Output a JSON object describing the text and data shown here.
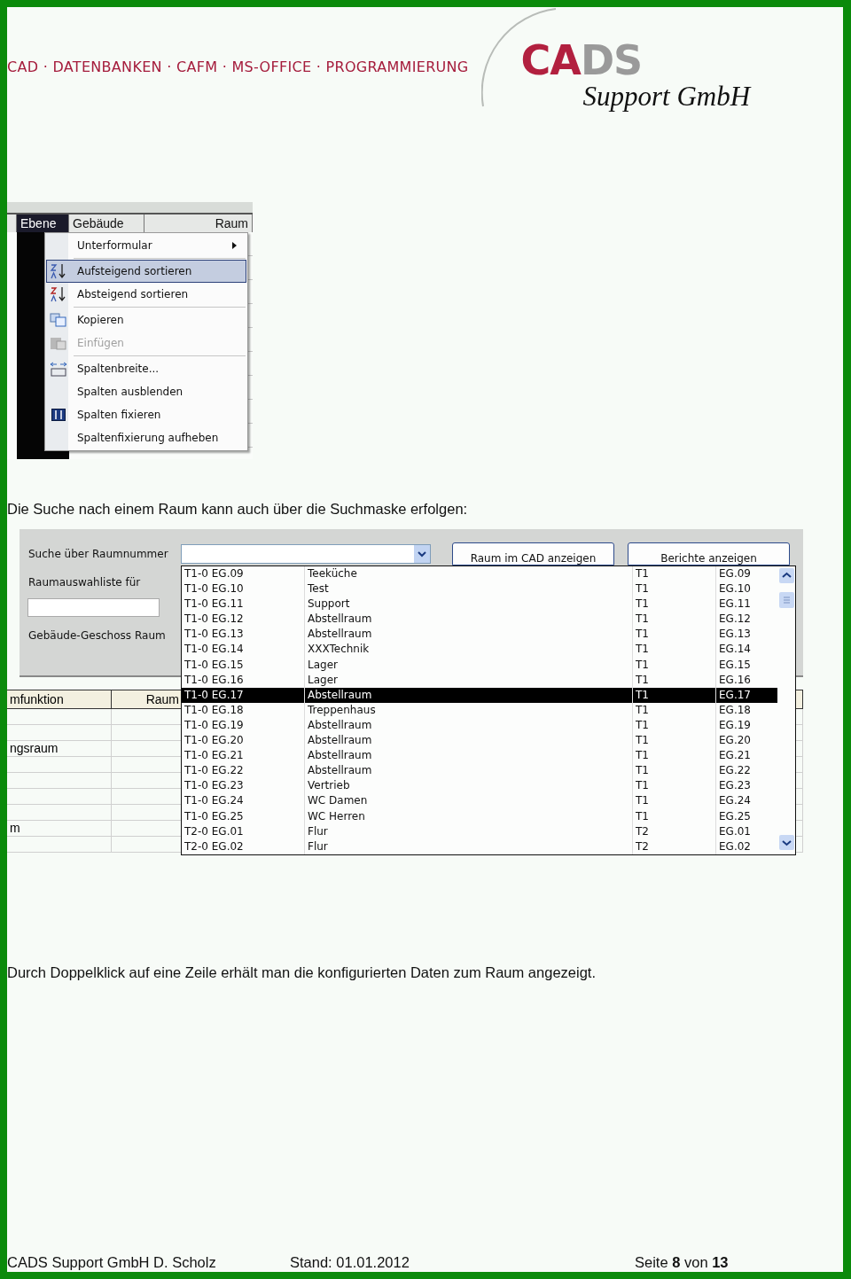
{
  "header": {
    "tagline": "CAD · DATENBANKEN · CAFM · MS-OFFICE · PROGRAMMIERUNG",
    "logo_accent": "CA",
    "logo_rest": "DS",
    "logo_subtitle": "Support GmbH"
  },
  "context_menu_shot": {
    "columns": [
      "Ebene",
      "Gebäude",
      "Raum"
    ],
    "menu_groups": [
      [
        {
          "label": "Unterformular",
          "submenu": true,
          "selected": false,
          "disabled": false
        }
      ],
      [
        {
          "label": "Aufsteigend sortieren",
          "submenu": false,
          "selected": true,
          "disabled": false
        },
        {
          "label": "Absteigend sortieren",
          "submenu": false,
          "selected": false,
          "disabled": false
        }
      ],
      [
        {
          "label": "Kopieren",
          "submenu": false,
          "selected": false,
          "disabled": false
        },
        {
          "label": "Einfügen",
          "submenu": false,
          "selected": false,
          "disabled": true
        }
      ],
      [
        {
          "label": "Spaltenbreite...",
          "submenu": false,
          "selected": false,
          "disabled": false
        },
        {
          "label": "Spalten ausblenden",
          "submenu": false,
          "selected": false,
          "disabled": false
        },
        {
          "label": "Spalten fixieren",
          "submenu": false,
          "selected": false,
          "disabled": false
        },
        {
          "label": "Spaltenfixierung aufheben",
          "submenu": false,
          "selected": false,
          "disabled": false
        }
      ]
    ]
  },
  "paragraph_1": "Die Suche nach einem Raum kann auch über die Suchmaske erfolgen:",
  "search_form_shot": {
    "search_label": "Suche über Raumnummer",
    "list_label": "Raumauswahliste für",
    "column_labels": [
      "Gebäude-Geschoss",
      "Raum"
    ],
    "buttons": [
      "Raum im CAD anzeigen",
      "Berichte anzeigen"
    ],
    "table_headers": [
      "mfunktion",
      "Raum"
    ],
    "table_cells": [
      "",
      "",
      "ngsraum",
      "",
      "",
      "",
      "",
      "m"
    ],
    "dropdown_rows": [
      {
        "cells": [
          "T1-0 EG.09",
          "Teeküche",
          "T1",
          "EG.09"
        ],
        "selected": false
      },
      {
        "cells": [
          "T1-0 EG.10",
          "Test",
          "T1",
          "EG.10"
        ],
        "selected": false
      },
      {
        "cells": [
          "T1-0 EG.11",
          "Support",
          "T1",
          "EG.11"
        ],
        "selected": false
      },
      {
        "cells": [
          "T1-0 EG.12",
          "Abstellraum",
          "T1",
          "EG.12"
        ],
        "selected": false
      },
      {
        "cells": [
          "T1-0 EG.13",
          "Abstellraum",
          "T1",
          "EG.13"
        ],
        "selected": false
      },
      {
        "cells": [
          "T1-0 EG.14",
          "XXXTechnik",
          "T1",
          "EG.14"
        ],
        "selected": false
      },
      {
        "cells": [
          "T1-0 EG.15",
          "Lager",
          "T1",
          "EG.15"
        ],
        "selected": false
      },
      {
        "cells": [
          "T1-0 EG.16",
          "Lager",
          "T1",
          "EG.16"
        ],
        "selected": false
      },
      {
        "cells": [
          "T1-0 EG.17",
          "Abstellraum",
          "T1",
          "EG.17"
        ],
        "selected": true
      },
      {
        "cells": [
          "T1-0 EG.18",
          "Treppenhaus",
          "T1",
          "EG.18"
        ],
        "selected": false
      },
      {
        "cells": [
          "T1-0 EG.19",
          "Abstellraum",
          "T1",
          "EG.19"
        ],
        "selected": false
      },
      {
        "cells": [
          "T1-0 EG.20",
          "Abstellraum",
          "T1",
          "EG.20"
        ],
        "selected": false
      },
      {
        "cells": [
          "T1-0 EG.21",
          "Abstellraum",
          "T1",
          "EG.21"
        ],
        "selected": false
      },
      {
        "cells": [
          "T1-0 EG.22",
          "Abstellraum",
          "T1",
          "EG.22"
        ],
        "selected": false
      },
      {
        "cells": [
          "T1-0 EG.23",
          "Vertrieb",
          "T1",
          "EG.23"
        ],
        "selected": false
      },
      {
        "cells": [
          "T1-0 EG.24",
          "WC Damen",
          "T1",
          "EG.24"
        ],
        "selected": false
      },
      {
        "cells": [
          "T1-0 EG.25",
          "WC Herren",
          "T1",
          "EG.25"
        ],
        "selected": false
      },
      {
        "cells": [
          "T2-0 EG.01",
          "Flur",
          "T2",
          "EG.01"
        ],
        "selected": false
      },
      {
        "cells": [
          "T2-0 EG.02",
          "Flur",
          "T2",
          "EG.02"
        ],
        "selected": false
      }
    ]
  },
  "paragraph_2": "Durch Doppelklick auf eine Zeile erhält man die konfigurierten Daten zum Raum angezeigt.",
  "footer": {
    "company": "CADS Support GmbH D. Scholz",
    "date": "Stand: 01.01.2012",
    "page": "Seite **8** von **13**"
  }
}
